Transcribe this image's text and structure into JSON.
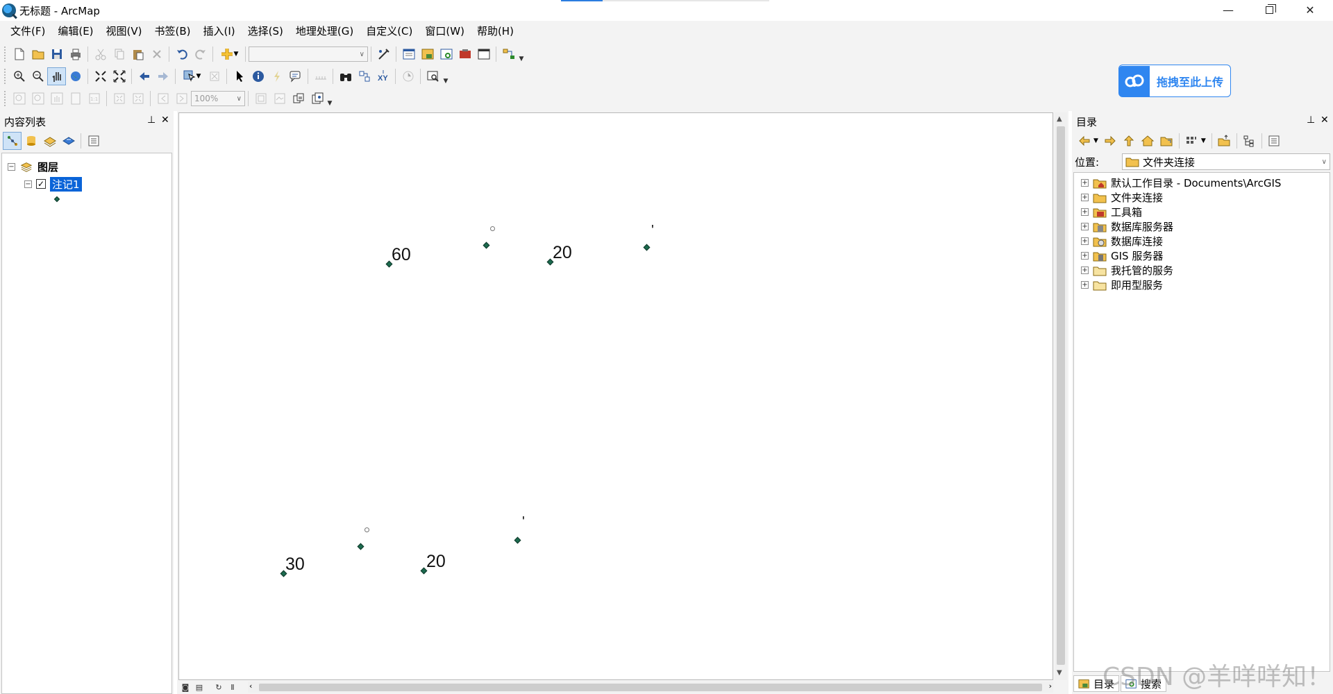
{
  "window": {
    "title": "无标题 - ArcMap"
  },
  "menu": [
    "文件(F)",
    "编辑(E)",
    "视图(V)",
    "书签(B)",
    "插入(I)",
    "选择(S)",
    "地理处理(G)",
    "自定义(C)",
    "窗口(W)",
    "帮助(H)"
  ],
  "toolbar": {
    "scale_value": "",
    "zoom_value": "100%"
  },
  "upload_button": {
    "label": "拖拽至此上传",
    "color": "#2f86f0"
  },
  "toc": {
    "title": "内容列表",
    "root_label": "图层",
    "layer_label": "注记1"
  },
  "map": {
    "labels": [
      "60",
      "20",
      "'",
      "30",
      "20",
      "'"
    ]
  },
  "catalog": {
    "title": "目录",
    "location_label": "位置:",
    "location_value": "文件夹连接",
    "items": [
      "默认工作目录 - Documents\\ArcGIS",
      "文件夹连接",
      "工具箱",
      "数据库服务器",
      "数据库连接",
      "GIS 服务器",
      "我托管的服务",
      "即用型服务"
    ],
    "bottom_tabs": [
      "目录",
      "搜索"
    ]
  },
  "watermark": "CSDN @羊咩咩知！",
  "colors": {
    "selection": "#0a64d8",
    "point": "#1c6b4f",
    "accent": "#2f86f0"
  }
}
